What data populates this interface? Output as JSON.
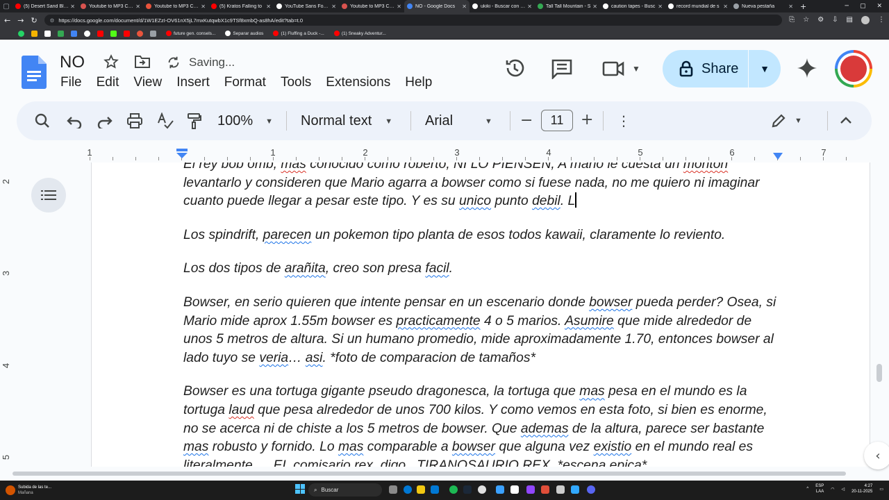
{
  "browser": {
    "tabs": [
      {
        "title": "(5) Desert Sand Blow",
        "color": "#ff0000"
      },
      {
        "title": "Youtube to MP3 Conv",
        "color": "#d9534f"
      },
      {
        "title": "Youtube to MP3 Conv",
        "color": "#e8543c"
      },
      {
        "title": "(5) Kratos Falling to",
        "color": "#ff0000"
      },
      {
        "title": "YouTube Sans Font F",
        "color": "#ffffff"
      },
      {
        "title": "Youtube to MP3 Conv",
        "color": "#d9534f"
      },
      {
        "title": "NO - Google Docs",
        "color": "#4285f4",
        "active": true
      },
      {
        "title": "ukiki - Buscar con Go",
        "color": "#ffffff"
      },
      {
        "title": "Tall Tall Mountain - S",
        "color": "#34a853"
      },
      {
        "title": "caution tapes - Busc",
        "color": "#ffffff"
      },
      {
        "title": "record mundial de s",
        "color": "#ffffff"
      },
      {
        "title": "Nueva pestaña",
        "color": "#9aa0a6"
      }
    ],
    "url": "https://docs.google.com/document/d/1W1EZzI-OV61nX5jL7mxKutqwbX1c9TSf8xmbQ-as8hA/edit?tab=t.0",
    "bookmarks": [
      {
        "label": "future gen. consels...",
        "color": "#ff0000"
      },
      {
        "label": "Separar audios",
        "color": "#ffffff"
      },
      {
        "label": "(1) Fluffing a Duck -...",
        "color": "#ff0000"
      },
      {
        "label": "(1) Sneaky Adventur...",
        "color": "#ff0000"
      }
    ]
  },
  "docs": {
    "title": "NO",
    "status": "Saving...",
    "menu": [
      "File",
      "Edit",
      "View",
      "Insert",
      "Format",
      "Tools",
      "Extensions",
      "Help"
    ],
    "share_label": "Share",
    "toolbar": {
      "zoom": "100%",
      "style": "Normal text",
      "font": "Arial",
      "font_size": "11"
    },
    "ruler_numbers": [
      "1",
      "1",
      "2",
      "3",
      "4",
      "5",
      "6",
      "7"
    ],
    "vruler_numbers": [
      "2",
      "3",
      "4",
      "5"
    ]
  },
  "document": {
    "paragraphs": [
      {
        "segments": [
          {
            "t": "El rey bob omb, "
          },
          {
            "t": "mas",
            "sq": "red"
          },
          {
            "t": " conocido como roberto, NI LO PIENSEN, A mano le cuesta un "
          },
          {
            "t": "monton",
            "sq": "red"
          },
          {
            "t": " levantarlo y consideren que Mario agarra a bowser como si fuese nada, no me quiero ni imaginar cuanto puede llegar a pesar este tipo. Y es su "
          },
          {
            "t": "unico",
            "sq": "blue"
          },
          {
            "t": " punto "
          },
          {
            "t": "debil",
            "sq": "blue"
          },
          {
            "t": ". L"
          }
        ],
        "cursor": true
      },
      {
        "segments": [
          {
            "t": "Los spindrift, "
          },
          {
            "t": "parecen",
            "sq": "blue"
          },
          {
            "t": " un pokemon tipo planta de esos todos kawaii, claramente lo reviento."
          }
        ]
      },
      {
        "segments": [
          {
            "t": "Los dos tipos de "
          },
          {
            "t": "arañita",
            "sq": "blue"
          },
          {
            "t": ", creo son presa "
          },
          {
            "t": "facil",
            "sq": "blue"
          },
          {
            "t": "."
          }
        ]
      },
      {
        "segments": [
          {
            "t": "Bowser, en serio quieren que intente pensar en un escenario donde "
          },
          {
            "t": "bowser",
            "sq": "blue"
          },
          {
            "t": " pueda perder? Osea, si Mario mide aprox 1.55m bowser es "
          },
          {
            "t": "practicamente",
            "sq": "blue"
          },
          {
            "t": " 4 o 5 marios. "
          },
          {
            "t": "Asumire",
            "sq": "blue"
          },
          {
            "t": " que mide alrededor de unos 5 metros de altura. Si un humano promedio, mide aproximadamente 1.70, entonces bowser al lado tuyo se "
          },
          {
            "t": "veria",
            "sq": "blue"
          },
          {
            "t": "… "
          },
          {
            "t": "asi",
            "sq": "blue"
          },
          {
            "t": ". *foto de comparacion de tamaños*"
          }
        ]
      },
      {
        "segments": [
          {
            "t": "Bowser es una tortuga gigante pseudo dragonesca, la tortuga que "
          },
          {
            "t": "mas",
            "sq": "blue"
          },
          {
            "t": " pesa en el mundo es la tortuga "
          },
          {
            "t": "laud",
            "sq": "red"
          },
          {
            "t": " que pesa alrededor de unos 700 kilos. Y como vemos en esta foto, si bien es enorme, no se acerca ni de chiste a los 5 metros de bowser. Que "
          },
          {
            "t": "ademas",
            "sq": "blue"
          },
          {
            "t": " de la altura, parece ser bastante "
          },
          {
            "t": "mas",
            "sq": "blue"
          },
          {
            "t": " robusto y fornido. Lo "
          },
          {
            "t": "mas",
            "sq": "blue"
          },
          {
            "t": " comparable a "
          },
          {
            "t": "bowser",
            "sq": "blue"
          },
          {
            "t": " que alguna vez "
          },
          {
            "t": "existio",
            "sq": "blue"
          },
          {
            "t": " en el mundo real es literalmente…. EL comisario rex, digo , TIRANOSAURIO REX. *escena epica*"
          }
        ]
      }
    ]
  },
  "taskbar": {
    "weather_title": "Subida de las te...",
    "weather_sub": "Mañana",
    "search_label": "Buscar",
    "lang_1": "ESP",
    "lang_2": "LAA",
    "time": "4:27",
    "date": "20-11-2025"
  }
}
